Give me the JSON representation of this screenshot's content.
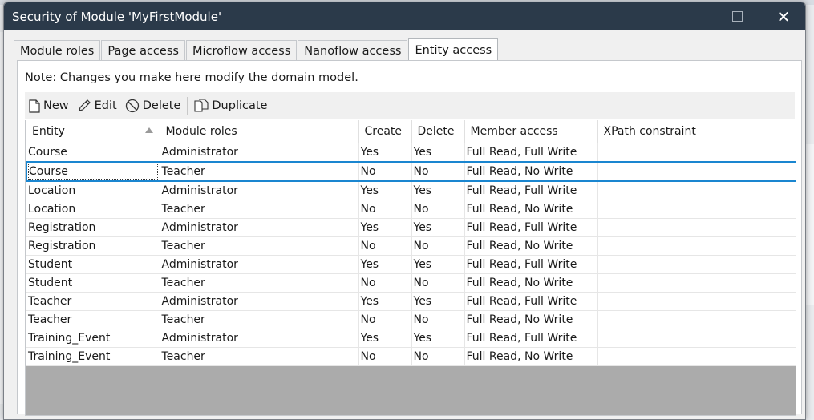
{
  "window": {
    "title": "Security of Module 'MyFirstModule'"
  },
  "tabs": [
    {
      "label": "Module roles",
      "active": false
    },
    {
      "label": "Page access",
      "active": false
    },
    {
      "label": "Microflow access",
      "active": false
    },
    {
      "label": "Nanoflow access",
      "active": false
    },
    {
      "label": "Entity access",
      "active": true
    }
  ],
  "note": "Note: Changes you make here modify the domain model.",
  "toolbar": {
    "new_label": "New",
    "edit_label": "Edit",
    "delete_label": "Delete",
    "duplicate_label": "Duplicate"
  },
  "table": {
    "columns": [
      "Entity",
      "Module roles",
      "Create",
      "Delete",
      "Member access",
      "XPath constraint"
    ],
    "sorted_column": "Entity",
    "selected_row": 1,
    "rows": [
      [
        "Course",
        "Administrator",
        "Yes",
        "Yes",
        "Full Read, Full Write",
        ""
      ],
      [
        "Course",
        "Teacher",
        "No",
        "No",
        "Full Read, No Write",
        ""
      ],
      [
        "Location",
        "Administrator",
        "Yes",
        "Yes",
        "Full Read, Full Write",
        ""
      ],
      [
        "Location",
        "Teacher",
        "No",
        "No",
        "Full Read, No Write",
        ""
      ],
      [
        "Registration",
        "Administrator",
        "Yes",
        "Yes",
        "Full Read, Full Write",
        ""
      ],
      [
        "Registration",
        "Teacher",
        "No",
        "No",
        "Full Read, No Write",
        ""
      ],
      [
        "Student",
        "Administrator",
        "Yes",
        "Yes",
        "Full Read, Full Write",
        ""
      ],
      [
        "Student",
        "Teacher",
        "No",
        "No",
        "Full Read, No Write",
        ""
      ],
      [
        "Teacher",
        "Administrator",
        "Yes",
        "Yes",
        "Full Read, Full Write",
        ""
      ],
      [
        "Teacher",
        "Teacher",
        "No",
        "No",
        "Full Read, No Write",
        ""
      ],
      [
        "Training_Event",
        "Administrator",
        "Yes",
        "Yes",
        "Full Read, Full Write",
        ""
      ],
      [
        "Training_Event",
        "Teacher",
        "No",
        "No",
        "Full Read, No Write",
        ""
      ]
    ]
  },
  "colors": {
    "titlebar": "#2b3a4a",
    "selection": "#1a86d0",
    "grid_empty": "#ababab"
  }
}
